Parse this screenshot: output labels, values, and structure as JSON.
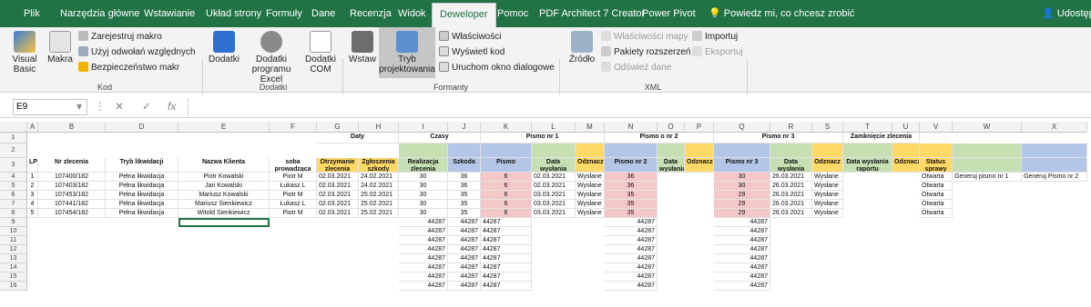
{
  "ribbon_tabs": [
    "Plik",
    "Narzędzia główne",
    "Wstawianie",
    "Układ strony",
    "Formuły",
    "Dane",
    "Recenzja",
    "Widok",
    "Deweloper",
    "Pomoc",
    "PDF Architect 7 Creator",
    "Power Pivot"
  ],
  "active_tab": "Deweloper",
  "tell_me": "Powiedz mi, co chcesz zrobić",
  "share": "Udostęp",
  "ribbon": {
    "visual_basic": "Visual Basic",
    "makra": "Makra",
    "record_macro": "Zarejestruj makro",
    "relative_refs": "Użyj odwołań względnych",
    "macro_security": "Bezpieczeństwo makr",
    "group_kod": "Kod",
    "dodatki": "Dodatki",
    "dodatki_excel": "Dodatki programu Excel",
    "dodatki_com": "Dodatki COM",
    "group_dodatki": "Dodatki",
    "wstaw": "Wstaw",
    "tryb": "Tryb projektowania",
    "wlasciwosci": "Właściwości",
    "wyswietl_kod": "Wyświetl kod",
    "uruchom_okno": "Uruchom okno dialogowe",
    "group_formanty": "Formanty",
    "zrodlo": "Źródło",
    "wlasciwosci_mapy": "Właściwości mapy",
    "pakiety": "Pakiety rozszerzeń",
    "odswiez": "Odśwież dane",
    "importuj": "Importuj",
    "eksportuj": "Eksportuj",
    "group_xml": "XML"
  },
  "formula_bar": {
    "name_box": "E9",
    "fx": "fx",
    "cancel": "✕",
    "enter": "✓"
  },
  "columns": [
    "A",
    "B",
    "D",
    "E",
    "F",
    "G",
    "H",
    "I",
    "J",
    "K",
    "L",
    "M",
    "N",
    "O",
    "P",
    "Q",
    "R",
    "S",
    "T",
    "U",
    "V",
    "W",
    "X"
  ],
  "row_numbers": [
    "1",
    "2",
    "3",
    "4",
    "5",
    "6",
    "7",
    "8",
    "9",
    "10",
    "11",
    "12",
    "13",
    "14",
    "15",
    "16"
  ],
  "row1": {
    "daty": "Daty",
    "czasy": "Czasy",
    "pismo1": "Pismo nr 1",
    "pismo2": "Pismo o nr 2",
    "pismo3": "Pismo nr 3",
    "zamkniecie": "Zamknięcie zlecenia"
  },
  "headers": {
    "lp": "LP",
    "nr": "Nr zlecenia",
    "tryb": "Tryb likwidacji",
    "klient": "Nazwa Klienta",
    "osoba": "soba prowadząca",
    "otrzymanie": "Otrzymanie zlecenia",
    "zgloszenie": "Zgłoszenia szkody",
    "realizacja": "Realizacja zlecenia",
    "szkoda": "Szkoda",
    "pismo": "Pismo",
    "data_wysl1": "Data wysłania",
    "odznacz1": "Odznacz",
    "pismo2": "Pismo nr 2",
    "data_wysl2": "Data wysłania",
    "odznacz2": "Odznacz",
    "pismo3": "Pismo nr 3",
    "data_wysl3": "Data wysłania",
    "odznacz3": "Odznacz",
    "data_raport": "Data wysłania raportu",
    "odznacz4": "Odznacz",
    "status": "Status sprawy"
  },
  "rows": [
    {
      "lp": "1",
      "nr": "107400/182",
      "tryb": "Pełna likwidacja",
      "klient": "Piotr Kowalski",
      "osoba": "Piotr M",
      "otrz": "02.03.2021",
      "zgl": "24.02.2021",
      "real": "30",
      "szk": "36",
      "p1": "6",
      "d1": "02.03.2021",
      "o1": "Wysłane",
      "p2": "36",
      "p3": "30",
      "d3": "26.03.2021",
      "o3": "Wysłane",
      "st": "Otwarta",
      "w": "Generuj pismo nr 1",
      "x": "Generuj Pismo nr 2"
    },
    {
      "lp": "2",
      "nr": "107403/182",
      "tryb": "Pełna likwidacja",
      "klient": "Jan Kowalski",
      "osoba": "Łukasz L",
      "otrz": "02.03.2021",
      "zgl": "24.02.2021",
      "real": "30",
      "szk": "36",
      "p1": "6",
      "d1": "02.03.2021",
      "o1": "Wysłane",
      "p2": "36",
      "p3": "30",
      "d3": "26.03.2021",
      "o3": "Wysłane",
      "st": "Otwarta",
      "w": "",
      "x": ""
    },
    {
      "lp": "3",
      "nr": "107453/182",
      "tryb": "Pełna likwidacja",
      "klient": "Mariusz Kowalski",
      "osoba": "Piotr M",
      "otrz": "02.03.2021",
      "zgl": "25.02.2021",
      "real": "30",
      "szk": "35",
      "p1": "6",
      "d1": "03.03.2021",
      "o1": "Wysłane",
      "p2": "35",
      "p3": "29",
      "d3": "26.03.2021",
      "o3": "Wysłane",
      "st": "Otwarta",
      "w": "",
      "x": ""
    },
    {
      "lp": "4",
      "nr": "107441/182",
      "tryb": "Pełna likwidacja",
      "klient": "Mariusz Sienkiewicz",
      "osoba": "Łukasz L",
      "otrz": "02.03.2021",
      "zgl": "25.02.2021",
      "real": "30",
      "szk": "35",
      "p1": "6",
      "d1": "03.03.2021",
      "o1": "Wysłane",
      "p2": "35",
      "p3": "29",
      "d3": "26.03.2021",
      "o3": "Wysłane",
      "st": "Otwarta",
      "w": "",
      "x": ""
    },
    {
      "lp": "5",
      "nr": "107454/182",
      "tryb": "Pełna likwidacja",
      "klient": "Witold Sienkiewicz",
      "osoba": "Piotr M",
      "otrz": "02.03.2021",
      "zgl": "25.02.2021",
      "real": "30",
      "szk": "35",
      "p1": "6",
      "d1": "03.03.2021",
      "o1": "Wysłane",
      "p2": "35",
      "p3": "29",
      "d3": "26.03.2021",
      "o3": "Wysłane",
      "st": "Otwarta",
      "w": "",
      "x": ""
    }
  ],
  "filler_value": "44287",
  "colors": {
    "excel_green": "#217346",
    "pink": "#f4c7c9",
    "green": "#c6e0b4",
    "yellow": "#ffd966",
    "blue": "#b4c6e7"
  }
}
